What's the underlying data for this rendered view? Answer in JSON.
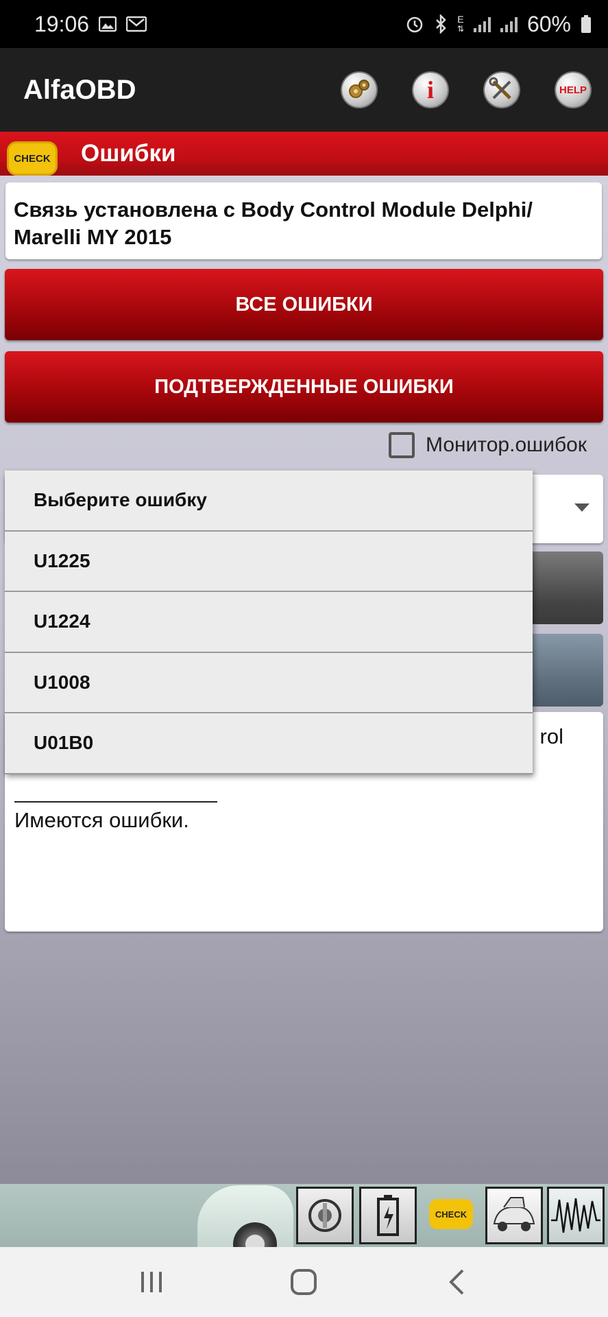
{
  "status_bar": {
    "time": "19:06",
    "left_icons": [
      "image-icon",
      "mail-icon"
    ],
    "right_icons": [
      "alarm-icon",
      "bluetooth-icon",
      "data-icon",
      "signal-icon",
      "signal-icon"
    ],
    "network_label": "E",
    "battery": "60%"
  },
  "app_bar": {
    "title": "AlfaOBD",
    "actions": [
      "settings-gears-icon",
      "info-icon",
      "tools-icon",
      "help-icon"
    ],
    "help_label": "HELP",
    "info_label": "i"
  },
  "section": {
    "badge": "CHECK",
    "title": "Ошибки"
  },
  "connection": {
    "text": " Связь установлена с Body Control Module Delphi/ Marelli MY 2015"
  },
  "buttons": {
    "all_errors": "ВСЕ ОШИБКИ",
    "confirmed_errors": "ПОДТВЕРЖДЕННЫЕ ОШИБКИ"
  },
  "monitor": {
    "label": "Монитор.ошибок",
    "checked": false
  },
  "dropdown": {
    "items": [
      {
        "label": "Выберите ошибку"
      },
      {
        "label": "U1225"
      },
      {
        "label": "U1224"
      },
      {
        "label": "U1008"
      },
      {
        "label": "U01B0"
      }
    ]
  },
  "result": {
    "fragment": "rol",
    "status": "Имеются ошибки."
  },
  "toolbar": {
    "items": [
      "car-photo",
      "key-ignition-icon",
      "battery-icon",
      "check-engine-icon",
      "car-hood-icon",
      "oscilloscope-icon"
    ],
    "check_label": "CHECK"
  },
  "nav": {
    "items": [
      "recent-apps-icon",
      "home-icon",
      "back-icon"
    ]
  },
  "colors": {
    "accent_red": "#c20e15",
    "check_yellow": "#f3c20b",
    "app_bar": "#1f1f1f"
  }
}
